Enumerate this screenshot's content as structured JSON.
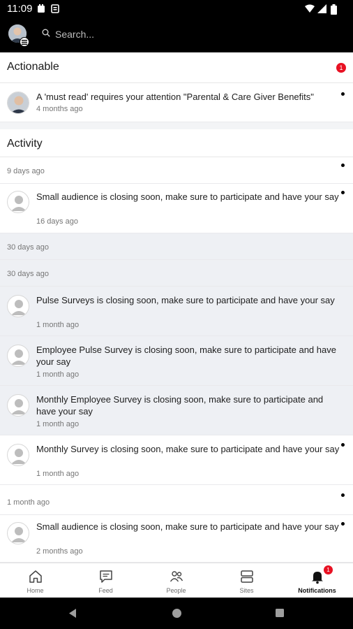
{
  "status_bar": {
    "time": "11:09"
  },
  "search": {
    "placeholder": "Search..."
  },
  "actionable": {
    "title": "Actionable",
    "badge": "1",
    "item": {
      "text": "A 'must read' requires your attention \"Parental & Care Giver Benefits\"",
      "time": "4 months ago"
    }
  },
  "activity": {
    "title": "Activity",
    "groups": [
      {
        "label": "9 days ago"
      },
      {
        "label": "30 days ago"
      },
      {
        "label": "30 days ago"
      },
      {
        "label": "1 month ago"
      }
    ],
    "items": [
      {
        "text": "Small audience is closing soon, make sure to participate and have your say",
        "time": "16 days ago"
      },
      {
        "text": "Pulse Surveys is closing soon, make sure to participate and have your say",
        "time": "1 month ago"
      },
      {
        "text": "Employee Pulse Survey is closing soon, make sure to participate and have your say",
        "time": "1 month ago"
      },
      {
        "text": "Monthly Employee Survey is closing soon, make sure to participate and have your say",
        "time": "1 month ago"
      },
      {
        "text": "Monthly Survey is closing soon, make sure to participate and have your say",
        "time": "1 month ago"
      },
      {
        "text": "Small audience is closing soon, make sure to participate and have your say",
        "time": "2 months ago"
      }
    ]
  },
  "bottom_nav": {
    "items": [
      {
        "label": "Home",
        "icon": "home-icon"
      },
      {
        "label": "Feed",
        "icon": "feed-icon"
      },
      {
        "label": "People",
        "icon": "people-icon"
      },
      {
        "label": "Sites",
        "icon": "sites-icon"
      },
      {
        "label": "Notifications",
        "icon": "bell-icon",
        "badge": "1"
      }
    ]
  },
  "colors": {
    "badge": "#e81123",
    "read_background": "#eef0f4"
  }
}
